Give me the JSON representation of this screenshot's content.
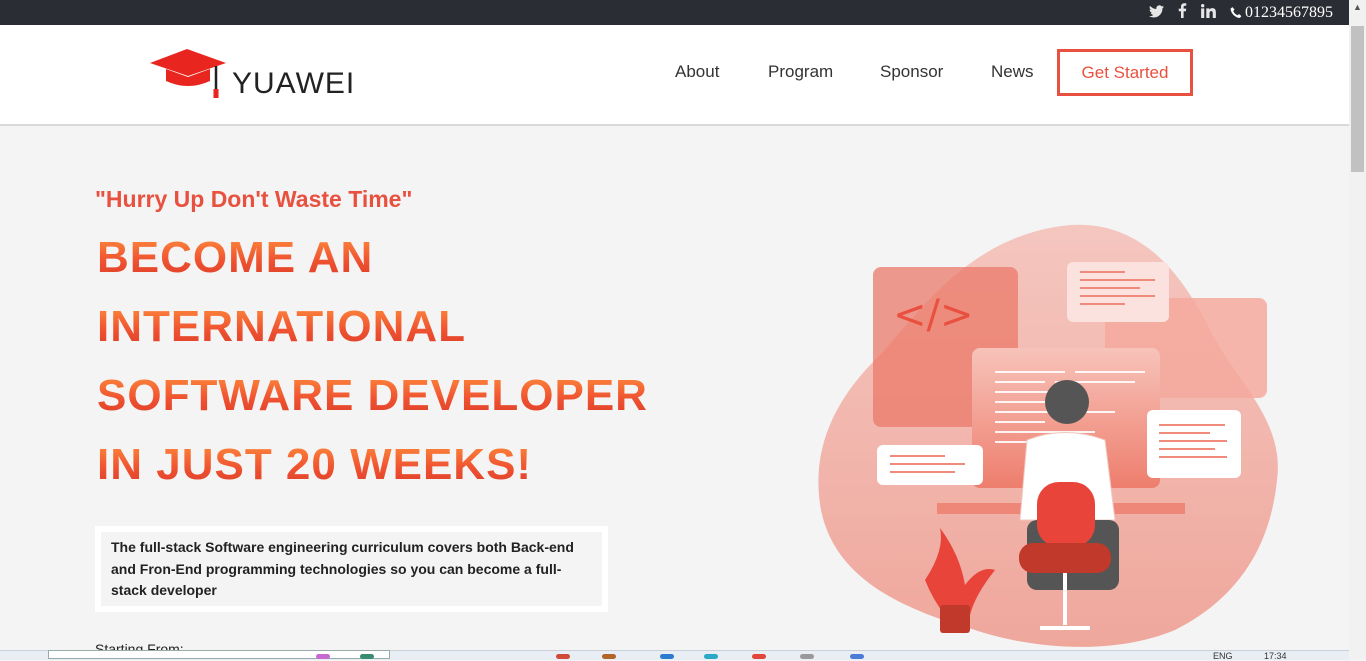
{
  "topbar": {
    "social": {
      "twitter_icon": "twitter-icon",
      "facebook_icon": "facebook-icon",
      "linkedin_icon": "linkedin-icon"
    },
    "phone": "01234567895"
  },
  "brand": {
    "name": "YUAWEI",
    "accent": "#e8513f"
  },
  "nav": {
    "items": [
      {
        "label": "About"
      },
      {
        "label": "Program"
      },
      {
        "label": "Sponsor"
      },
      {
        "label": "News"
      }
    ],
    "cta": "Get Started"
  },
  "hero": {
    "tagline": "\"Hurry Up Don't Waste Time\"",
    "headline": [
      "BECOME AN",
      "INTERNATIONAL",
      "SOFTWARE DEVELOPER",
      "IN JUST 20 WEEKS!"
    ],
    "description": "The full-stack Software engineering curriculum covers both Back-end and Fron-End programming technologies so you can become a full-stack developer",
    "starting": "Starting From:"
  },
  "illustration": {
    "code_symbol": "</>"
  },
  "taskbar": {
    "lang": "ENG",
    "time": "17:34"
  }
}
